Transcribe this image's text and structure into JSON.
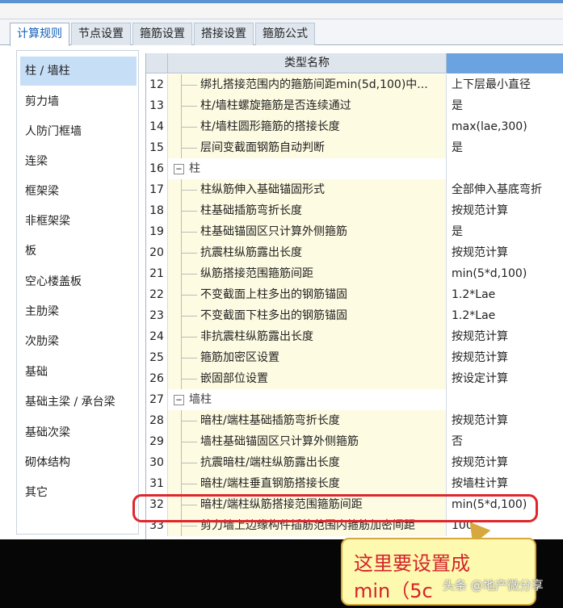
{
  "tabs": [
    {
      "label": "计算规则",
      "active": true
    },
    {
      "label": "节点设置",
      "active": false
    },
    {
      "label": "箍筋设置",
      "active": false
    },
    {
      "label": "搭接设置",
      "active": false
    },
    {
      "label": "箍筋公式",
      "active": false
    }
  ],
  "sidebar": {
    "items": [
      {
        "label": "柱 / 墙柱",
        "active": true
      },
      {
        "label": "剪力墙"
      },
      {
        "label": "人防门框墙"
      },
      {
        "label": "连梁"
      },
      {
        "label": "框架梁"
      },
      {
        "label": "非框架梁"
      },
      {
        "label": "板"
      },
      {
        "label": "空心楼盖板"
      },
      {
        "label": "主肋梁"
      },
      {
        "label": "次肋梁"
      },
      {
        "label": "基础"
      },
      {
        "label": "基础主梁 / 承台梁"
      },
      {
        "label": "基础次梁"
      },
      {
        "label": "砌体结构"
      },
      {
        "label": "其它"
      }
    ]
  },
  "grid": {
    "header_name": "类型名称",
    "collapse_glyph": "−",
    "rows": [
      {
        "num": "12",
        "name": "绑扎搭接范围内的箍筋间距min(5d,100)中...",
        "value": "上下层最小直径"
      },
      {
        "num": "13",
        "name": "柱/墙柱螺旋箍筋是否连续通过",
        "value": "是"
      },
      {
        "num": "14",
        "name": "柱/墙柱圆形箍筋的搭接长度",
        "value": "max(lae,300)"
      },
      {
        "num": "15",
        "name": "层间变截面钢筋自动判断",
        "value": "是"
      },
      {
        "num": "16",
        "name": "柱",
        "value": "",
        "group": true
      },
      {
        "num": "17",
        "name": "柱纵筋伸入基础锚固形式",
        "value": "全部伸入基底弯折"
      },
      {
        "num": "18",
        "name": "柱基础插筋弯折长度",
        "value": "按规范计算"
      },
      {
        "num": "19",
        "name": "柱基础锚固区只计算外侧箍筋",
        "value": "是"
      },
      {
        "num": "20",
        "name": "抗震柱纵筋露出长度",
        "value": "按规范计算"
      },
      {
        "num": "21",
        "name": "纵筋搭接范围箍筋间距",
        "value": "min(5*d,100)"
      },
      {
        "num": "22",
        "name": "不变截面上柱多出的钢筋锚固",
        "value": "1.2*Lae"
      },
      {
        "num": "23",
        "name": "不变截面下柱多出的钢筋锚固",
        "value": "1.2*Lae"
      },
      {
        "num": "24",
        "name": "非抗震柱纵筋露出长度",
        "value": "按规范计算"
      },
      {
        "num": "25",
        "name": "箍筋加密区设置",
        "value": "按规范计算"
      },
      {
        "num": "26",
        "name": "嵌固部位设置",
        "value": "按设定计算"
      },
      {
        "num": "27",
        "name": "墙柱",
        "value": "",
        "group": true
      },
      {
        "num": "28",
        "name": "暗柱/端柱基础插筋弯折长度",
        "value": "按规范计算"
      },
      {
        "num": "29",
        "name": "墙柱基础锚固区只计算外侧箍筋",
        "value": "否"
      },
      {
        "num": "30",
        "name": "抗震暗柱/端柱纵筋露出长度",
        "value": "按规范计算"
      },
      {
        "num": "31",
        "name": "暗柱/端柱垂直钢筋搭接长度",
        "value": "按墙柱计算"
      },
      {
        "num": "32",
        "name": "暗柱/端柱纵筋搭接范围箍筋间距",
        "value": "min(5*d,100)"
      },
      {
        "num": "33",
        "name": "剪力墙上边缘构件插筋范围内箍筋加密间距",
        "value": "100"
      }
    ]
  },
  "callout": {
    "line1": "这里要设置成",
    "line2": "min（5c"
  },
  "watermark": "头条 @地产微分享",
  "colors": {
    "highlight": "#e0262c",
    "callout_bg": "#fdf9ae",
    "callout_text": "#d4232b",
    "name_cell_bg": "#fdfbe2",
    "active_tab_text": "#1560b8",
    "sidebar_active_bg": "#c6def6"
  }
}
